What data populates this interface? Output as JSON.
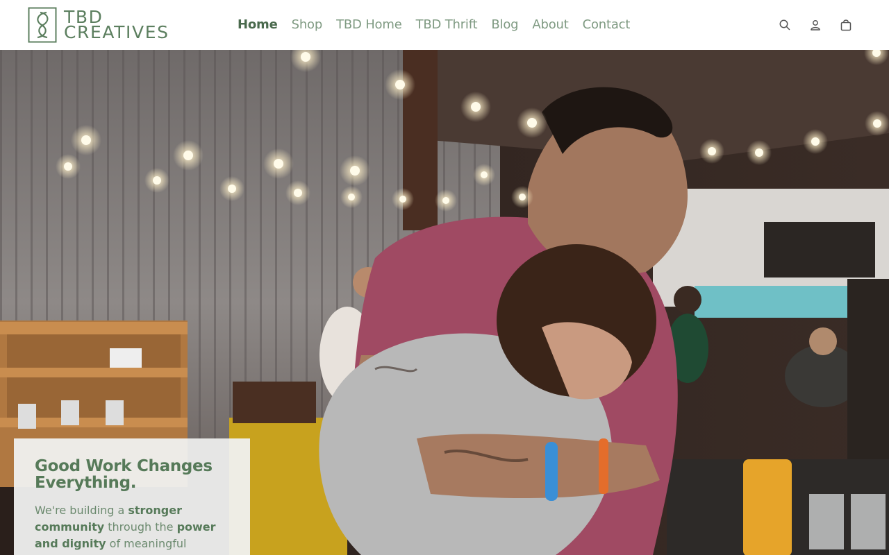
{
  "header": {
    "logo": {
      "line1": "TBD",
      "line2": "CREATIVES"
    },
    "nav": [
      {
        "label": "Home",
        "active": true
      },
      {
        "label": "Shop",
        "active": false
      },
      {
        "label": "TBD Home",
        "active": false
      },
      {
        "label": "TBD Thrift",
        "active": false
      },
      {
        "label": "Blog",
        "active": false
      },
      {
        "label": "About",
        "active": false
      },
      {
        "label": "Contact",
        "active": false
      }
    ],
    "icons": [
      "search-icon",
      "account-icon",
      "cart-icon"
    ]
  },
  "hero": {
    "image": "photo of a man in a maroon t-shirt hugging a boy in a grey hoodie at an indoor event with string lights",
    "card": {
      "title": "Good Work Changes Everything.",
      "body_1": "We're building a ",
      "body_2": "stronger community",
      "body_3": " through the ",
      "body_4": "power and dignity",
      "body_5": " of meaningful"
    }
  },
  "colors": {
    "brand_green": "#5c7f5f",
    "nav_green": "#7f9a82",
    "active_green": "#4a6a4d"
  }
}
